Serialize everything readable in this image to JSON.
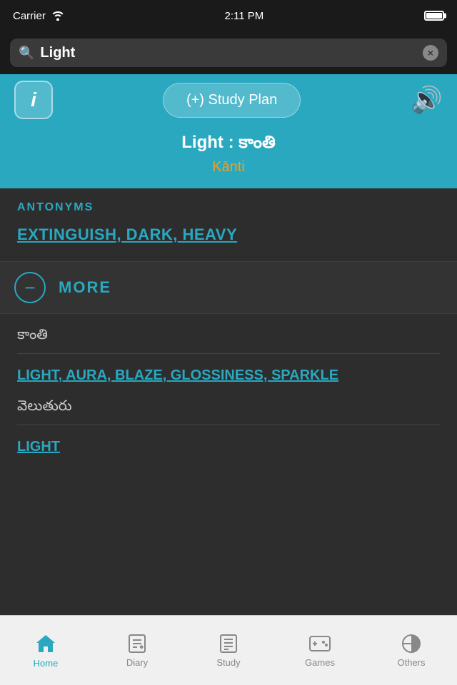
{
  "status_bar": {
    "carrier": "Carrier",
    "time": "2:11 PM",
    "battery": "100"
  },
  "search": {
    "placeholder": "Search",
    "current_value": "Light",
    "clear_label": "×"
  },
  "action_row": {
    "info_label": "i",
    "study_plan_label": "(+) Study Plan",
    "sound_label": "🔊"
  },
  "word": {
    "title": "Light",
    "separator": " : ",
    "native": "కాంతి",
    "transliteration": "Kānti"
  },
  "antonyms": {
    "section_label": "ANTONYMS",
    "words": "EXTINGUISH, DARK, HEAVY"
  },
  "more": {
    "label": "MORE"
  },
  "definitions": [
    {
      "telugu": "కాంతి",
      "english": "LIGHT, AURA, BLAZE, GLOSSINESS, SPARKLE"
    },
    {
      "telugu": "వెలుతురు",
      "english": "LIGHT"
    }
  ],
  "tabs": [
    {
      "id": "home",
      "label": "Home",
      "icon": "🏠",
      "active": true
    },
    {
      "id": "diary",
      "label": "Diary",
      "icon": "📝",
      "active": false
    },
    {
      "id": "study",
      "label": "Study",
      "icon": "📋",
      "active": false
    },
    {
      "id": "games",
      "label": "Games",
      "icon": "🎮",
      "active": false
    },
    {
      "id": "others",
      "label": "Others",
      "icon": "⏱",
      "active": false
    }
  ]
}
